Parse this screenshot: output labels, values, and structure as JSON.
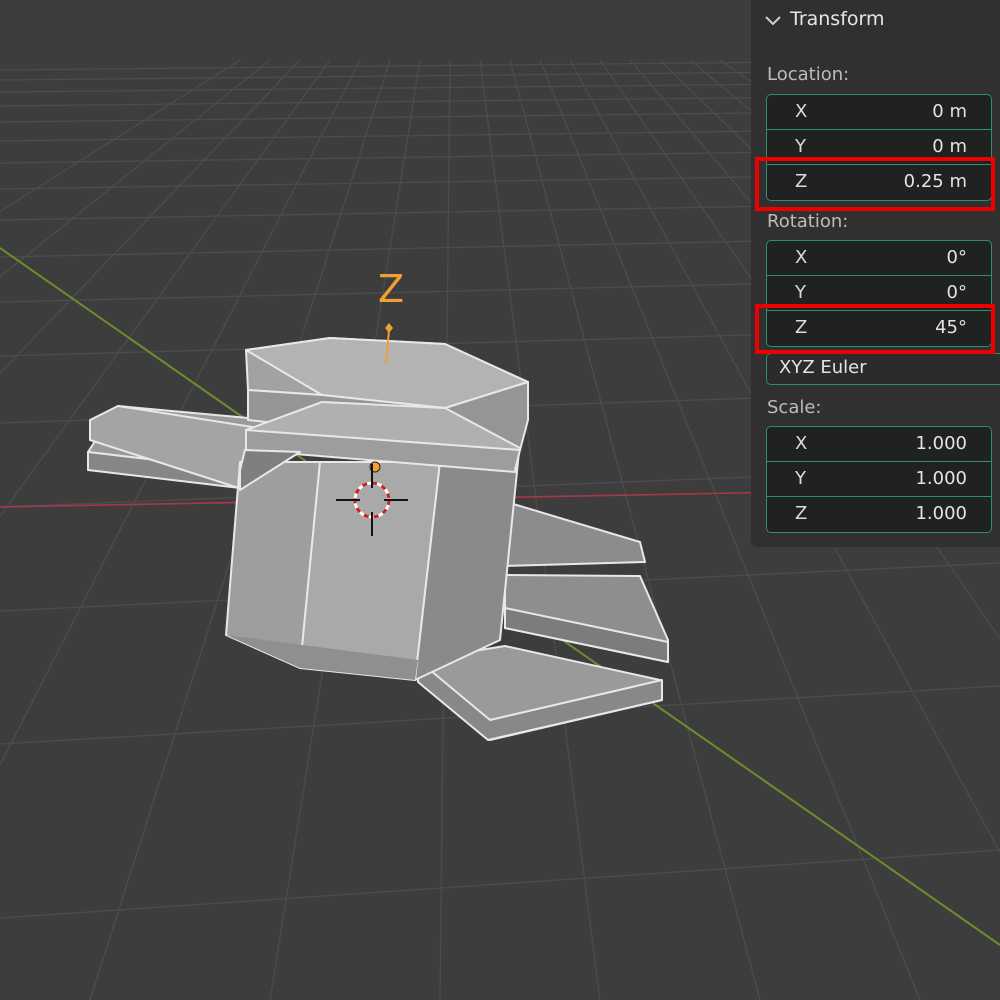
{
  "viewport": {
    "gizmo_axis_label": "Z"
  },
  "panel": {
    "title": "Transform",
    "location": {
      "label": "Location:",
      "x": {
        "axis": "X",
        "value": "0 m"
      },
      "y": {
        "axis": "Y",
        "value": "0 m"
      },
      "z": {
        "axis": "Z",
        "value": "0.25 m"
      }
    },
    "rotation": {
      "label": "Rotation:",
      "x": {
        "axis": "X",
        "value": "0°"
      },
      "y": {
        "axis": "Y",
        "value": "0°"
      },
      "z": {
        "axis": "Z",
        "value": "45°"
      },
      "mode": "XYZ Euler"
    },
    "scale": {
      "label": "Scale:",
      "x": {
        "axis": "X",
        "value": "1.000"
      },
      "y": {
        "axis": "Y",
        "value": "1.000"
      },
      "z": {
        "axis": "Z",
        "value": "1.000"
      }
    }
  },
  "colors": {
    "viewport_bg": "#3d3d3d",
    "grid_line": "#4b4b4b",
    "x_axis": "#b0384a",
    "y_axis": "#6a8f2c",
    "field_border": "#2e8f6e",
    "highlight": "#ee0000",
    "gizmo": "#f0a030"
  }
}
